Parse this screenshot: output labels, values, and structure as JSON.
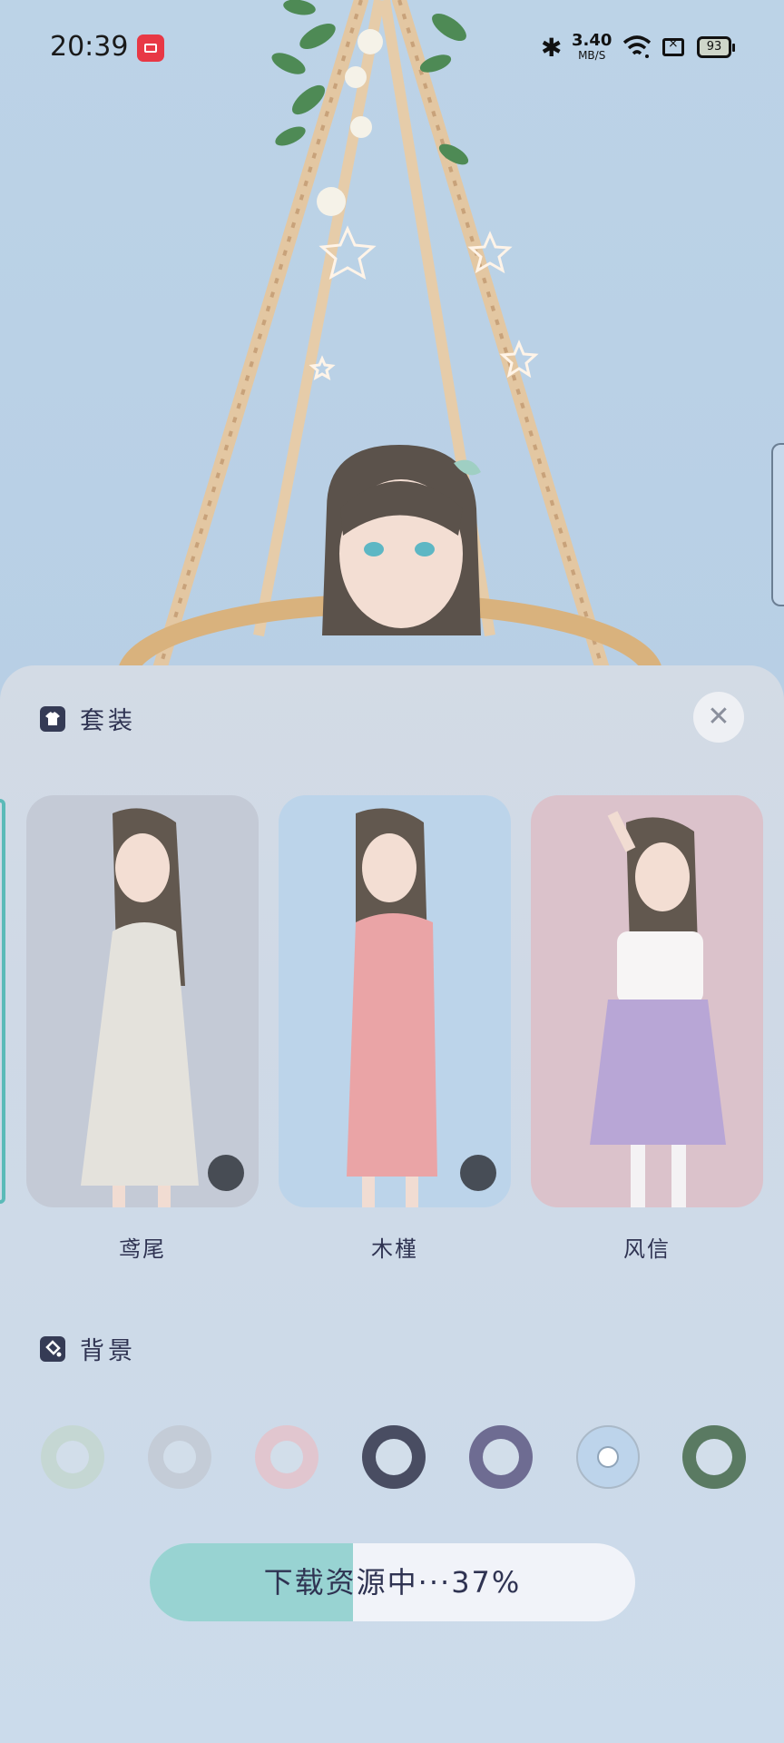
{
  "status_bar": {
    "time": "20:39",
    "speed_value": "3.40",
    "speed_unit": "MB/S",
    "battery": "93"
  },
  "outfits": {
    "title": "套装",
    "items": [
      {
        "label": "鸢尾",
        "bg": "#c4cad6",
        "dress": "#e4e2dc"
      },
      {
        "label": "木槿",
        "bg": "#bcd4ea",
        "dress": "#eaa4a6"
      },
      {
        "label": "风信",
        "bg": "#dbc2cb",
        "dress": "#b8a6d6"
      }
    ]
  },
  "background": {
    "title": "背景",
    "swatches": [
      {
        "ring": "#c5d7d3",
        "state": "normal"
      },
      {
        "ring": "#c4ccd7",
        "state": "normal"
      },
      {
        "ring": "#e1c6cf",
        "state": "normal"
      },
      {
        "ring": "#494d62",
        "state": "normal"
      },
      {
        "ring": "#6e6c92",
        "state": "normal"
      },
      {
        "ring": "#bdd4eb",
        "state": "selected"
      },
      {
        "ring": "#5a7a62",
        "state": "normal"
      }
    ]
  },
  "download": {
    "label": "下载资源中···37%",
    "progress": 0.37
  }
}
